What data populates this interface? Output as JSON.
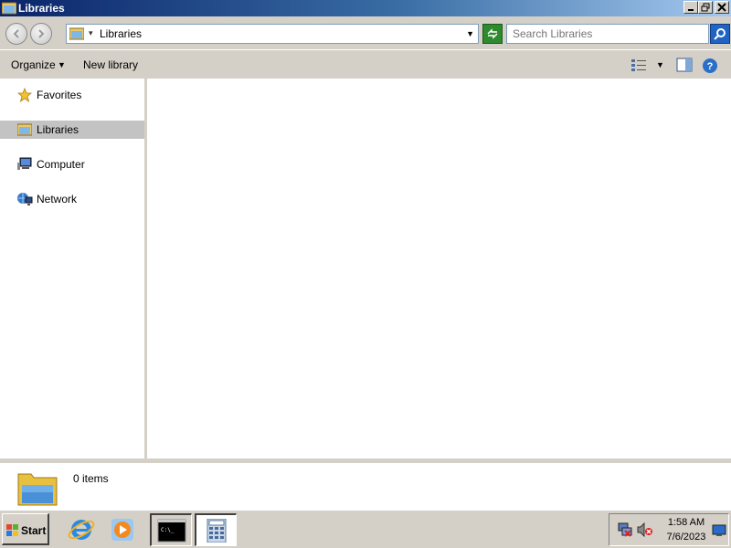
{
  "window": {
    "title": "Libraries",
    "icon": "libraries-folder-icon"
  },
  "address_bar": {
    "path": "Libraries",
    "search_placeholder": "Search Libraries"
  },
  "toolbar": {
    "organize_label": "Organize",
    "new_library_label": "New library"
  },
  "navigation": {
    "items": [
      {
        "label": "Favorites",
        "icon": "star-icon"
      },
      {
        "label": "Libraries",
        "icon": "libraries-icon",
        "selected": true
      },
      {
        "label": "Computer",
        "icon": "computer-icon"
      },
      {
        "label": "Network",
        "icon": "network-icon"
      }
    ]
  },
  "details": {
    "item_count": "0 items"
  },
  "taskbar": {
    "start_label": "Start",
    "pinned": [
      "internet-explorer-icon",
      "media-player-icon"
    ],
    "open_windows": [
      "command-prompt-icon",
      "calculator-icon"
    ],
    "clock_time": "1:58 AM",
    "clock_date": "7/6/2023"
  },
  "colors": {
    "title_gradient_start": "#0a246a",
    "title_gradient_end": "#a6caf0",
    "selection": "#c3c3c3",
    "chrome": "#d4d0c8"
  }
}
